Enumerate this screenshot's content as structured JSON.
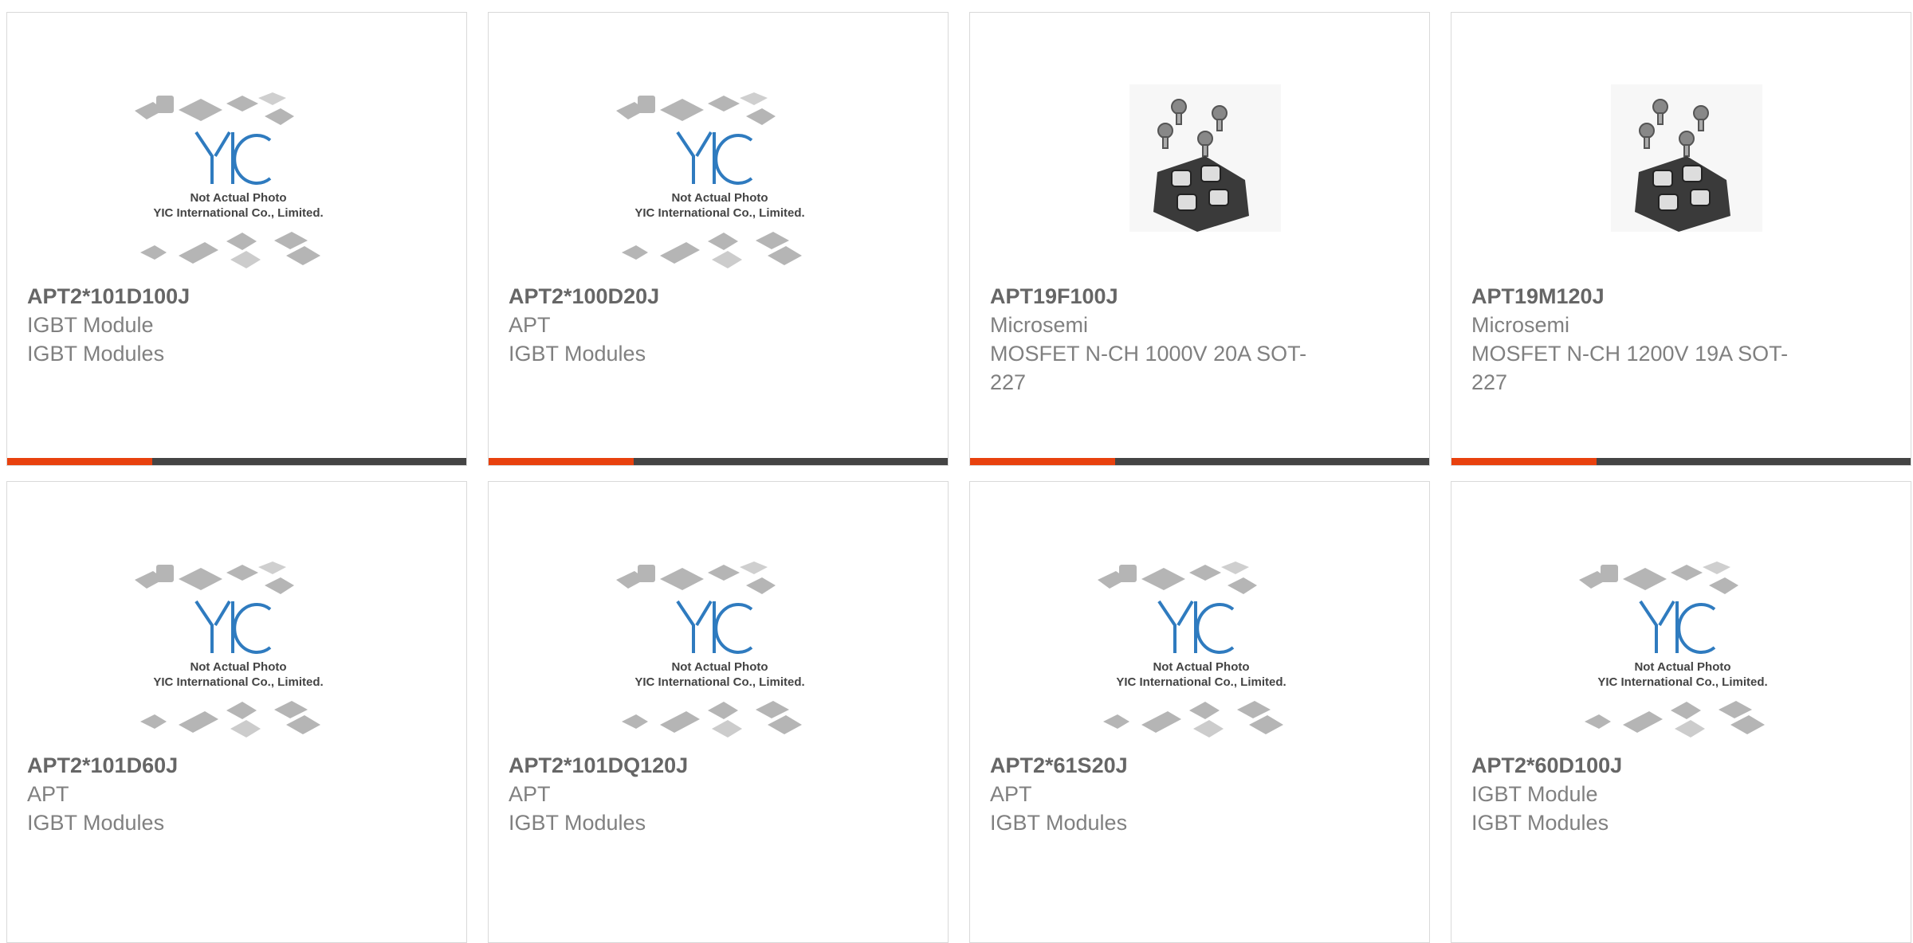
{
  "brand_colors": {
    "accent": "#e8410e",
    "bar_dark": "#444444",
    "logo_blue": "#2f7bbf"
  },
  "placeholder_image": {
    "logo_text": "YIC",
    "line1": "Not Actual Photo",
    "line2": "YIC International Co., Limited."
  },
  "products": [
    {
      "part_number": "APT2*101D100J",
      "manufacturer": "IGBT Module",
      "description": "IGBT Modules",
      "image": "placeholder"
    },
    {
      "part_number": "APT2*100D20J",
      "manufacturer": "APT",
      "description": "IGBT Modules",
      "image": "placeholder"
    },
    {
      "part_number": "APT19F100J",
      "manufacturer": "Microsemi",
      "description": "MOSFET N-CH 1000V 20A SOT-227",
      "image": "module-photo"
    },
    {
      "part_number": "APT19M120J",
      "manufacturer": "Microsemi",
      "description": "MOSFET N-CH 1200V 19A SOT-227",
      "image": "module-photo"
    },
    {
      "part_number": "APT2*101D60J",
      "manufacturer": "APT",
      "description": "IGBT Modules",
      "image": "placeholder"
    },
    {
      "part_number": "APT2*101DQ120J",
      "manufacturer": "APT",
      "description": "IGBT Modules",
      "image": "placeholder"
    },
    {
      "part_number": "APT2*61S20J",
      "manufacturer": "APT",
      "description": "IGBT Modules",
      "image": "placeholder"
    },
    {
      "part_number": "APT2*60D100J",
      "manufacturer": "IGBT Module",
      "description": "IGBT Modules",
      "image": "placeholder"
    }
  ]
}
